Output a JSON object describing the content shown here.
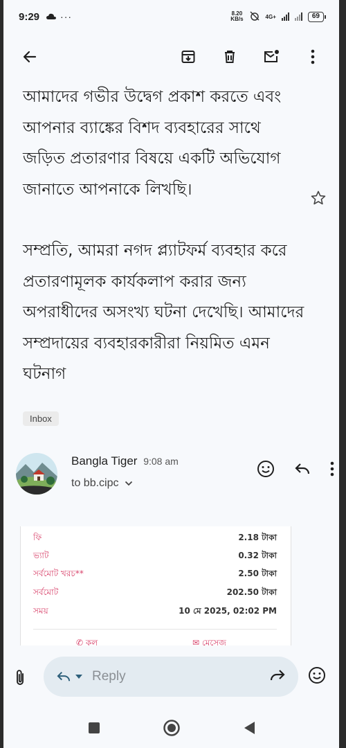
{
  "status_bar": {
    "time": "9:29",
    "net_speed_top": "8.20",
    "net_speed_bottom": "KB/s",
    "network_type": "4G+",
    "battery": "69"
  },
  "toolbar": {
    "icons": [
      "back-arrow-icon",
      "archive-icon",
      "delete-icon",
      "mark-unread-icon",
      "more-vert-icon"
    ]
  },
  "email": {
    "paragraph1": "আমাদের গভীর উদ্বেগ প্রকাশ করতে এবং আপনার ব্যাঙ্কের বিশদ ব্যবহারের সাথে জড়িত প্রতারণার বিষয়ে একটি অভিযোগ জানাতে আপনাকে লিখছি।",
    "paragraph2": "সম্প্রতি, আমরা নগদ প্ল্যাটফর্ম ব্যবহার করে প্রতারণামূলক কার্যকলাপ করার জন্য অপরাধীদের অসংখ্য ঘটনা দেখেছি। আমাদের সম্প্রদায়ের ব্যবহারকারীরা নিয়মিত এমন ঘটনাগ",
    "label": "Inbox"
  },
  "sender": {
    "name": "Bangla Tiger",
    "time": "9:08 am",
    "to": "to bb.cipc"
  },
  "receipt": {
    "rows": [
      {
        "key": "ফি",
        "value": "2.18 টাকা"
      },
      {
        "key": "ভ্যাট",
        "value": "0.32 টাকা"
      },
      {
        "key": "সর্বমোট খরচ**",
        "value": "2.50 টাকা"
      },
      {
        "key": "সর্বমোট",
        "value": "202.50 টাকা"
      },
      {
        "key": "সময়",
        "value": "10 মে 2025, 02:02 PM"
      }
    ],
    "footer_left": "কল",
    "footer_right": "মেসেজ"
  },
  "reply": {
    "placeholder": "Reply"
  },
  "colors": {
    "background": "#f7f9fc",
    "reply_pill": "#e3ebf1",
    "receipt_accent": "#d8426a"
  }
}
